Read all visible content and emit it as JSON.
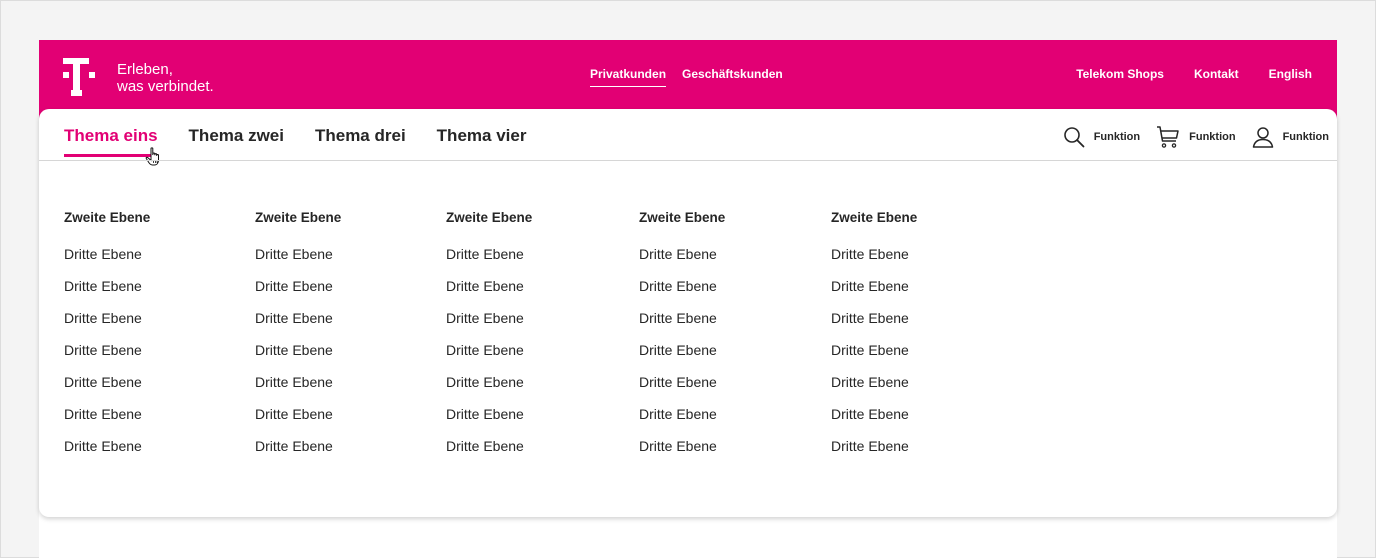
{
  "brand": {
    "tagline_line1": "Erleben,",
    "tagline_line2": "was verbindet.",
    "brand_color": "#e20074",
    "logo_icon": "telekom-t-logo"
  },
  "segments": [
    {
      "label": "Privatkunden",
      "active": true
    },
    {
      "label": "Geschäftskunden",
      "active": false
    }
  ],
  "meta_links": [
    "Telekom Shops",
    "Kontakt",
    "English"
  ],
  "main_nav": [
    {
      "label": "Thema eins",
      "active": true
    },
    {
      "label": "Thema zwei",
      "active": false
    },
    {
      "label": "Thema drei",
      "active": false
    },
    {
      "label": "Thema vier",
      "active": false
    }
  ],
  "functions": [
    {
      "icon": "search-icon",
      "label": "Funktion"
    },
    {
      "icon": "cart-icon",
      "label": "Funktion"
    },
    {
      "icon": "user-icon",
      "label": "Funktion"
    }
  ],
  "flyout": {
    "columns": [
      {
        "heading": "Zweite Ebene",
        "items": [
          "Dritte Ebene",
          "Dritte Ebene",
          "Dritte Ebene",
          "Dritte Ebene",
          "Dritte Ebene",
          "Dritte Ebene",
          "Dritte Ebene"
        ]
      },
      {
        "heading": "Zweite Ebene",
        "items": [
          "Dritte Ebene",
          "Dritte Ebene",
          "Dritte Ebene",
          "Dritte Ebene",
          "Dritte Ebene",
          "Dritte Ebene",
          "Dritte Ebene"
        ]
      },
      {
        "heading": "Zweite Ebene",
        "items": [
          "Dritte Ebene",
          "Dritte Ebene",
          "Dritte Ebene",
          "Dritte Ebene",
          "Dritte Ebene",
          "Dritte Ebene",
          "Dritte Ebene"
        ]
      },
      {
        "heading": "Zweite Ebene",
        "items": [
          "Dritte Ebene",
          "Dritte Ebene",
          "Dritte Ebene",
          "Dritte Ebene",
          "Dritte Ebene",
          "Dritte Ebene",
          "Dritte Ebene"
        ]
      },
      {
        "heading": "Zweite Ebene",
        "items": [
          "Dritte Ebene",
          "Dritte Ebene",
          "Dritte Ebene",
          "Dritte Ebene",
          "Dritte Ebene",
          "Dritte Ebene",
          "Dritte Ebene"
        ]
      }
    ]
  }
}
